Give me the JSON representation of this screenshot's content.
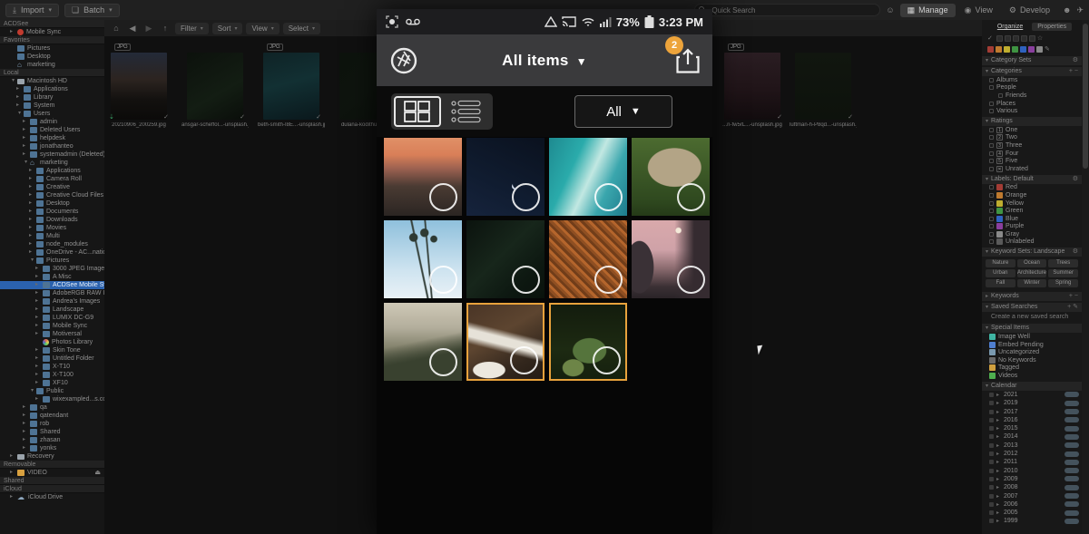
{
  "desktop": {
    "topbar": {
      "import_label": "Import",
      "batch_label": "Batch",
      "search_placeholder": "Quick Search",
      "modes": [
        {
          "label": "Manage",
          "icon": "grid",
          "active": true
        },
        {
          "label": "View",
          "icon": "eye",
          "active": false
        },
        {
          "label": "Develop",
          "icon": "sliders",
          "active": false
        }
      ]
    },
    "browse_toolbar": {
      "menus": [
        "Filter",
        "Sort",
        "View",
        "Select"
      ]
    },
    "sidebar": [
      {
        "t": "h",
        "l": "ACDSee"
      },
      {
        "t": "i",
        "l": "Mobile Sync",
        "d": 1,
        "ic": "sync",
        "closed": true
      },
      {
        "t": "h",
        "l": "Favorites"
      },
      {
        "t": "i",
        "l": "Pictures",
        "d": 1,
        "ic": "folder"
      },
      {
        "t": "i",
        "l": "Desktop",
        "d": 1,
        "ic": "folder"
      },
      {
        "t": "i",
        "l": "marketing",
        "d": 1,
        "ic": "home"
      },
      {
        "t": "h",
        "l": "Local"
      },
      {
        "t": "i",
        "l": "Macintosh HD",
        "d": 1,
        "ic": "drive",
        "open": true
      },
      {
        "t": "i",
        "l": "Applications",
        "d": 2,
        "ic": "folder",
        "closed": true
      },
      {
        "t": "i",
        "l": "Library",
        "d": 2,
        "ic": "folder",
        "closed": true
      },
      {
        "t": "i",
        "l": "System",
        "d": 2,
        "ic": "folder",
        "closed": true
      },
      {
        "t": "i",
        "l": "Users",
        "d": 2,
        "ic": "folder",
        "open": true
      },
      {
        "t": "i",
        "l": "admin",
        "d": 3,
        "ic": "folder",
        "closed": true
      },
      {
        "t": "i",
        "l": "Deleted Users",
        "d": 3,
        "ic": "folder",
        "closed": true
      },
      {
        "t": "i",
        "l": "helpdesk",
        "d": 3,
        "ic": "folder",
        "closed": true
      },
      {
        "t": "i",
        "l": "jonathanteo",
        "d": 3,
        "ic": "folder",
        "closed": true
      },
      {
        "t": "i",
        "l": "systemadmin (Deleted)",
        "d": 3,
        "ic": "folder",
        "closed": true
      },
      {
        "t": "i",
        "l": "marketing",
        "d": 3,
        "ic": "home",
        "open": true
      },
      {
        "t": "i",
        "l": "Applications",
        "d": 4,
        "ic": "folder",
        "closed": true
      },
      {
        "t": "i",
        "l": "Camera Roll",
        "d": 4,
        "ic": "folder",
        "closed": true
      },
      {
        "t": "i",
        "l": "Creative",
        "d": 4,
        "ic": "folder",
        "closed": true
      },
      {
        "t": "i",
        "l": "Creative Cloud Files",
        "d": 4,
        "ic": "folder",
        "closed": true
      },
      {
        "t": "i",
        "l": "Desktop",
        "d": 4,
        "ic": "folder",
        "closed": true
      },
      {
        "t": "i",
        "l": "Documents",
        "d": 4,
        "ic": "folder",
        "closed": true
      },
      {
        "t": "i",
        "l": "Downloads",
        "d": 4,
        "ic": "folder",
        "closed": true
      },
      {
        "t": "i",
        "l": "Movies",
        "d": 4,
        "ic": "folder",
        "closed": true
      },
      {
        "t": "i",
        "l": "Multi",
        "d": 4,
        "ic": "folder",
        "closed": true
      },
      {
        "t": "i",
        "l": "node_modules",
        "d": 4,
        "ic": "folder",
        "closed": true
      },
      {
        "t": "i",
        "l": "OneDrive - AC...national Inc",
        "d": 4,
        "ic": "folder",
        "closed": true
      },
      {
        "t": "i",
        "l": "Pictures",
        "d": 4,
        "ic": "folder",
        "open": true
      },
      {
        "t": "i",
        "l": "3000 JPEG Images",
        "d": 5,
        "ic": "folder",
        "closed": true
      },
      {
        "t": "i",
        "l": "A Misc",
        "d": 5,
        "ic": "folder",
        "closed": true
      },
      {
        "t": "i",
        "l": "ACDSee Mobile Sync",
        "d": 5,
        "ic": "folder",
        "closed": true,
        "sel": true
      },
      {
        "t": "i",
        "l": "AdobeRGB RAW Images",
        "d": 5,
        "ic": "folder",
        "closed": true
      },
      {
        "t": "i",
        "l": "Andrea's Images",
        "d": 5,
        "ic": "folder",
        "closed": true
      },
      {
        "t": "i",
        "l": "Landscape",
        "d": 5,
        "ic": "folder",
        "closed": true
      },
      {
        "t": "i",
        "l": "LUMIX DC-G9",
        "d": 5,
        "ic": "folder",
        "closed": true
      },
      {
        "t": "i",
        "l": "Mobile Sync",
        "d": 5,
        "ic": "folder",
        "closed": true
      },
      {
        "t": "i",
        "l": "Motiversal",
        "d": 5,
        "ic": "folder",
        "closed": true
      },
      {
        "t": "i",
        "l": "Photos Library",
        "d": 5,
        "ic": "photos"
      },
      {
        "t": "i",
        "l": "Skin Tone",
        "d": 5,
        "ic": "folder",
        "closed": true
      },
      {
        "t": "i",
        "l": "Untitled Folder",
        "d": 5,
        "ic": "folder",
        "closed": true
      },
      {
        "t": "i",
        "l": "X-T10",
        "d": 5,
        "ic": "folder",
        "closed": true
      },
      {
        "t": "i",
        "l": "X-T100",
        "d": 5,
        "ic": "folder",
        "closed": true
      },
      {
        "t": "i",
        "l": "XF10",
        "d": 5,
        "ic": "folder",
        "closed": true
      },
      {
        "t": "i",
        "l": "Public",
        "d": 4,
        "ic": "folder",
        "open": true
      },
      {
        "t": "i",
        "l": "wixexampled...s.com Creative",
        "d": 5,
        "ic": "folder",
        "closed": true
      },
      {
        "t": "i",
        "l": "qa",
        "d": 3,
        "ic": "folder",
        "closed": true
      },
      {
        "t": "i",
        "l": "qatendant",
        "d": 3,
        "ic": "folder",
        "closed": true
      },
      {
        "t": "i",
        "l": "rob",
        "d": 3,
        "ic": "folder",
        "closed": true
      },
      {
        "t": "i",
        "l": "Shared",
        "d": 3,
        "ic": "folder",
        "closed": true
      },
      {
        "t": "i",
        "l": "zhasan",
        "d": 3,
        "ic": "folder",
        "closed": true
      },
      {
        "t": "i",
        "l": "yonks",
        "d": 3,
        "ic": "folder",
        "closed": true
      },
      {
        "t": "i",
        "l": "Recovery",
        "d": 1,
        "ic": "drive",
        "closed": true
      },
      {
        "t": "h",
        "l": "Removable"
      },
      {
        "t": "i",
        "l": "VIDEO",
        "d": 1,
        "ic": "video",
        "closed": true,
        "eject": true
      },
      {
        "t": "h",
        "l": "Shared"
      },
      {
        "t": "h",
        "l": "iCloud"
      },
      {
        "t": "i",
        "l": "iCloud Drive",
        "d": 1,
        "ic": "cloud",
        "closed": true
      }
    ],
    "thumbs": [
      {
        "name": "20210906_200259.jpg",
        "badge": "JPG",
        "style": "t1",
        "dl": true,
        "side": "left"
      },
      {
        "name": "ansgar-scheffol...-unsplash.jpg",
        "badge": "",
        "style": "t2",
        "side": "left"
      },
      {
        "name": "beth-smith-I8E...-unsplash.jpg",
        "badge": "JPG",
        "style": "t3",
        "side": "left"
      },
      {
        "name": "dulana-kodithu...-un...",
        "badge": "",
        "style": "t4",
        "side": "left"
      },
      {
        "name": "...n-fw5rL...-unsplash.jpg",
        "badge": "JPG",
        "style": "t5",
        "side": "right"
      },
      {
        "name": "luftman-h-P8qd...-unsplash.jpg",
        "badge": "",
        "style": "t6",
        "side": "right"
      }
    ],
    "right_panel": {
      "tabs": [
        {
          "label": "Organize",
          "active": true
        },
        {
          "label": "Properties",
          "active": false
        }
      ],
      "headers": {
        "category_sets": "Category Sets",
        "categories": "Categories",
        "ratings": "Ratings",
        "labels": "Labels: Default",
        "keyword_sets": "Keyword Sets: Landscape",
        "keywords": "Keywords",
        "saved_searches": "Saved Searches",
        "special_items": "Special Items",
        "calendar": "Calendar"
      },
      "categories": [
        {
          "label": "Albums",
          "depth": 0
        },
        {
          "label": "People",
          "depth": 0,
          "open": true
        },
        {
          "label": "Friends",
          "depth": 1
        },
        {
          "label": "Places",
          "depth": 0
        },
        {
          "label": "Various",
          "depth": 0
        }
      ],
      "rating_items": [
        {
          "label": "One",
          "num": "1"
        },
        {
          "label": "Two",
          "num": "2"
        },
        {
          "label": "Three",
          "num": "3"
        },
        {
          "label": "Four",
          "num": "4"
        },
        {
          "label": "Five",
          "num": "5"
        },
        {
          "label": "Unrated",
          "num": "✕"
        }
      ],
      "label_items": [
        {
          "label": "Red",
          "color": "#a33c35"
        },
        {
          "label": "Orange",
          "color": "#bf7a2f"
        },
        {
          "label": "Yellow",
          "color": "#bfae2f"
        },
        {
          "label": "Green",
          "color": "#3f9442"
        },
        {
          "label": "Blue",
          "color": "#2f62bf"
        },
        {
          "label": "Purple",
          "color": "#8a3f9e"
        },
        {
          "label": "Gray",
          "color": "#8a8a8a"
        },
        {
          "label": "Unlabeled",
          "color": "#5a5a5a"
        }
      ],
      "keyword_buttons": [
        "Nature",
        "Ocean",
        "Trees",
        "Urban",
        "Architecture",
        "Summer",
        "Fall",
        "Winter",
        "Spring"
      ],
      "saved_search_hint": "Create a new saved search",
      "special_items": [
        {
          "label": "Image Well",
          "color": "#3fb5a3"
        },
        {
          "label": "Embed Pending",
          "color": "#4f7fd0"
        },
        {
          "label": "Uncategorized",
          "color": "#7a9ab0"
        },
        {
          "label": "No Keywords",
          "color": "#6a6a6a"
        },
        {
          "label": "Tagged",
          "color": "#d0a03f"
        },
        {
          "label": "Videos",
          "color": "#4fae4f"
        }
      ],
      "calendar_years": [
        "2021",
        "2019",
        "2017",
        "2016",
        "2015",
        "2014",
        "2013",
        "2012",
        "2011",
        "2010",
        "2009",
        "2008",
        "2007",
        "2006",
        "2005",
        "1999"
      ]
    }
  },
  "phone": {
    "status": {
      "battery": "73%",
      "time": "3:23 PM"
    },
    "appbar": {
      "title": "All items",
      "share_badge": "2"
    },
    "toolbar": {
      "filter_label": "All"
    },
    "photos": [
      {
        "name": "sunset-mountain-ridge",
        "selected": false
      },
      {
        "name": "night-sky-crescent-moon",
        "selected": false
      },
      {
        "name": "turquoise-ocean-wave",
        "selected": false
      },
      {
        "name": "elephant-in-grass",
        "selected": false
      },
      {
        "name": "palm-trees-sky",
        "selected": false
      },
      {
        "name": "dark-green-leaves",
        "selected": false
      },
      {
        "name": "autumn-forest-aerial",
        "selected": false
      },
      {
        "name": "pink-dusk-pines",
        "selected": false
      },
      {
        "name": "misty-mountain-forest",
        "selected": false
      },
      {
        "name": "canyon-river-falls",
        "selected": true
      },
      {
        "name": "forest-clearing",
        "selected": true
      }
    ]
  }
}
